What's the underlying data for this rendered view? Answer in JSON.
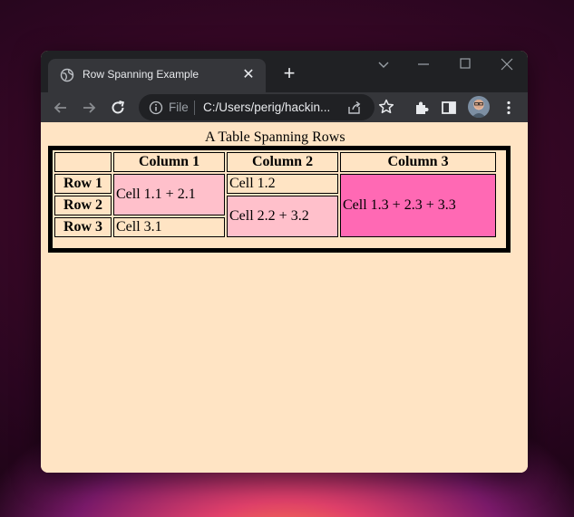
{
  "browser": {
    "tab_title": "Row Spanning Example",
    "omnibox_prefix": "File",
    "url": "C:/Users/perig/hackin..."
  },
  "page": {
    "caption": "A Table Spanning Rows",
    "table": {
      "headers": [
        "",
        "Column 1",
        "Column 2",
        "Column 3"
      ],
      "row_headers": [
        "Row 1",
        "Row 2",
        "Row 3"
      ],
      "cells": {
        "c11_21": "Cell 1.1 + 2.1",
        "c12": "Cell 1.2",
        "c13_23_33": "Cell 1.3 + 2.3 + 3.3",
        "c22_32": "Cell 2.2 + 3.2",
        "c31": "Cell 3.1"
      },
      "colors": {
        "page_bg": "#ffe4c4",
        "span_light_pink": "#ffc0cb",
        "span_hot_pink": "#ff69b4"
      }
    }
  }
}
